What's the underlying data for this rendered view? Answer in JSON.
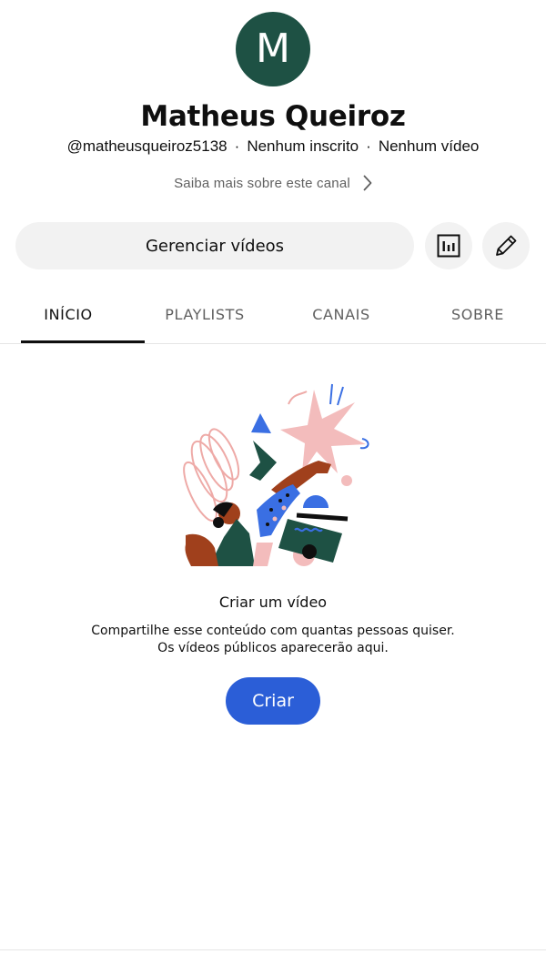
{
  "channel": {
    "avatar_letter": "M",
    "name": "Matheus Queiroz",
    "handle": "@matheusqueiroz5138",
    "subscribers": "Nenhum inscrito",
    "videos": "Nenhum vídeo",
    "separator": "·",
    "more_link": "Saiba mais sobre este canal"
  },
  "actions": {
    "manage_videos": "Gerenciar vídeos",
    "analytics_icon": "analytics-icon",
    "edit_icon": "pencil-icon"
  },
  "tabs": [
    {
      "label": "INÍCIO",
      "active": true
    },
    {
      "label": "PLAYLISTS",
      "active": false
    },
    {
      "label": "CANAIS",
      "active": false
    },
    {
      "label": "SOBRE",
      "active": false
    }
  ],
  "empty_state": {
    "title": "Criar um vídeo",
    "line1": "Compartilhe esse conteúdo com quantas pessoas quiser.",
    "line2": "Os vídeos públicos aparecerão aqui.",
    "button": "Criar"
  },
  "colors": {
    "avatar_bg": "#1e5144",
    "primary_button": "#2b5ed7",
    "chip_bg": "#f2f2f2"
  }
}
